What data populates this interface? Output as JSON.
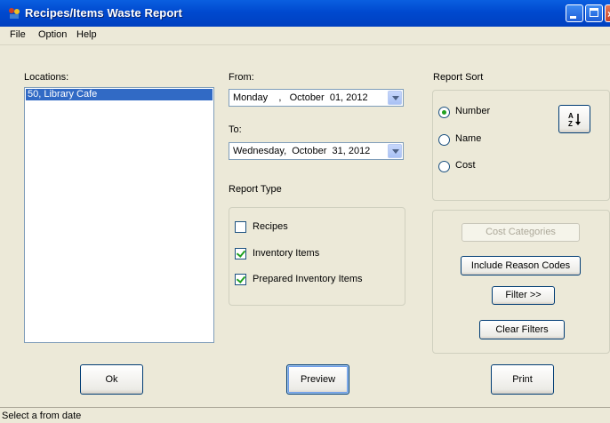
{
  "window": {
    "title": "Recipes/Items Waste Report"
  },
  "menu": {
    "items": [
      "File",
      "Option",
      "Help"
    ]
  },
  "locations": {
    "label": "Locations:",
    "items": [
      "50, Library Cafe"
    ]
  },
  "dates": {
    "from_label": "From:",
    "from_value": "Monday    ,   October  01, 2012",
    "to_label": "To:",
    "to_value": "Wednesday,  October  31, 2012"
  },
  "report_type": {
    "label": "Report Type",
    "options": [
      {
        "label": "Recipes",
        "checked": false
      },
      {
        "label": "Inventory Items",
        "checked": true
      },
      {
        "label": "Prepared Inventory Items",
        "checked": true
      }
    ]
  },
  "report_sort": {
    "label": "Report Sort",
    "options": [
      {
        "label": "Number",
        "selected": true
      },
      {
        "label": "Name",
        "selected": false
      },
      {
        "label": "Cost",
        "selected": false
      }
    ]
  },
  "filters": {
    "cost_categories": "Cost Categories",
    "include_reason_codes": "Include Reason Codes",
    "filter": "Filter >>",
    "clear_filters": "Clear Filters"
  },
  "actions": {
    "ok": "Ok",
    "preview": "Preview",
    "print": "Print"
  },
  "status": {
    "text": "Select a from date"
  }
}
